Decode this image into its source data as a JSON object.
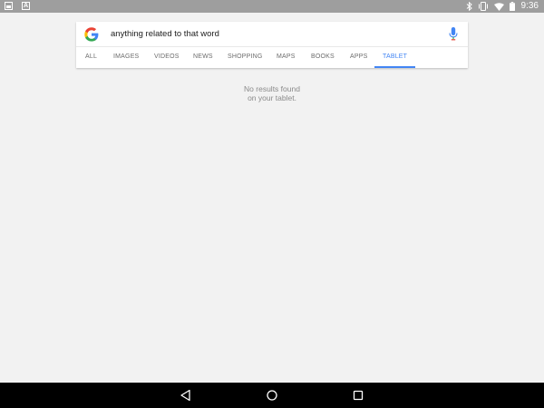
{
  "status_bar": {
    "left_icons": [
      "photo-icon",
      "a-icon"
    ],
    "a_icon_glyph": "A",
    "right_icons": [
      "bluetooth-icon",
      "vibrate-icon",
      "wifi-icon",
      "battery-icon"
    ],
    "time": "9:36",
    "background": "#9e9e9e"
  },
  "search": {
    "logo": "google-g-icon",
    "query": "anything related to that word",
    "mic_icon": "mic-icon"
  },
  "tabs": [
    {
      "label": "ALL",
      "active": false
    },
    {
      "label": "IMAGES",
      "active": false
    },
    {
      "label": "VIDEOS",
      "active": false
    },
    {
      "label": "NEWS",
      "active": false
    },
    {
      "label": "SHOPPING",
      "active": false
    },
    {
      "label": "MAPS",
      "active": false
    },
    {
      "label": "BOOKS",
      "active": false
    },
    {
      "label": "APPS",
      "active": false
    },
    {
      "label": "TABLET",
      "active": true
    }
  ],
  "results": {
    "empty_line1": "No results found",
    "empty_line2": "on your tablet."
  },
  "nav_bar": {
    "buttons": [
      "back-icon",
      "home-icon",
      "recents-icon"
    ]
  },
  "colors": {
    "accent": "#4285f4",
    "background": "#f2f2f2",
    "nav_bar": "#000000"
  }
}
